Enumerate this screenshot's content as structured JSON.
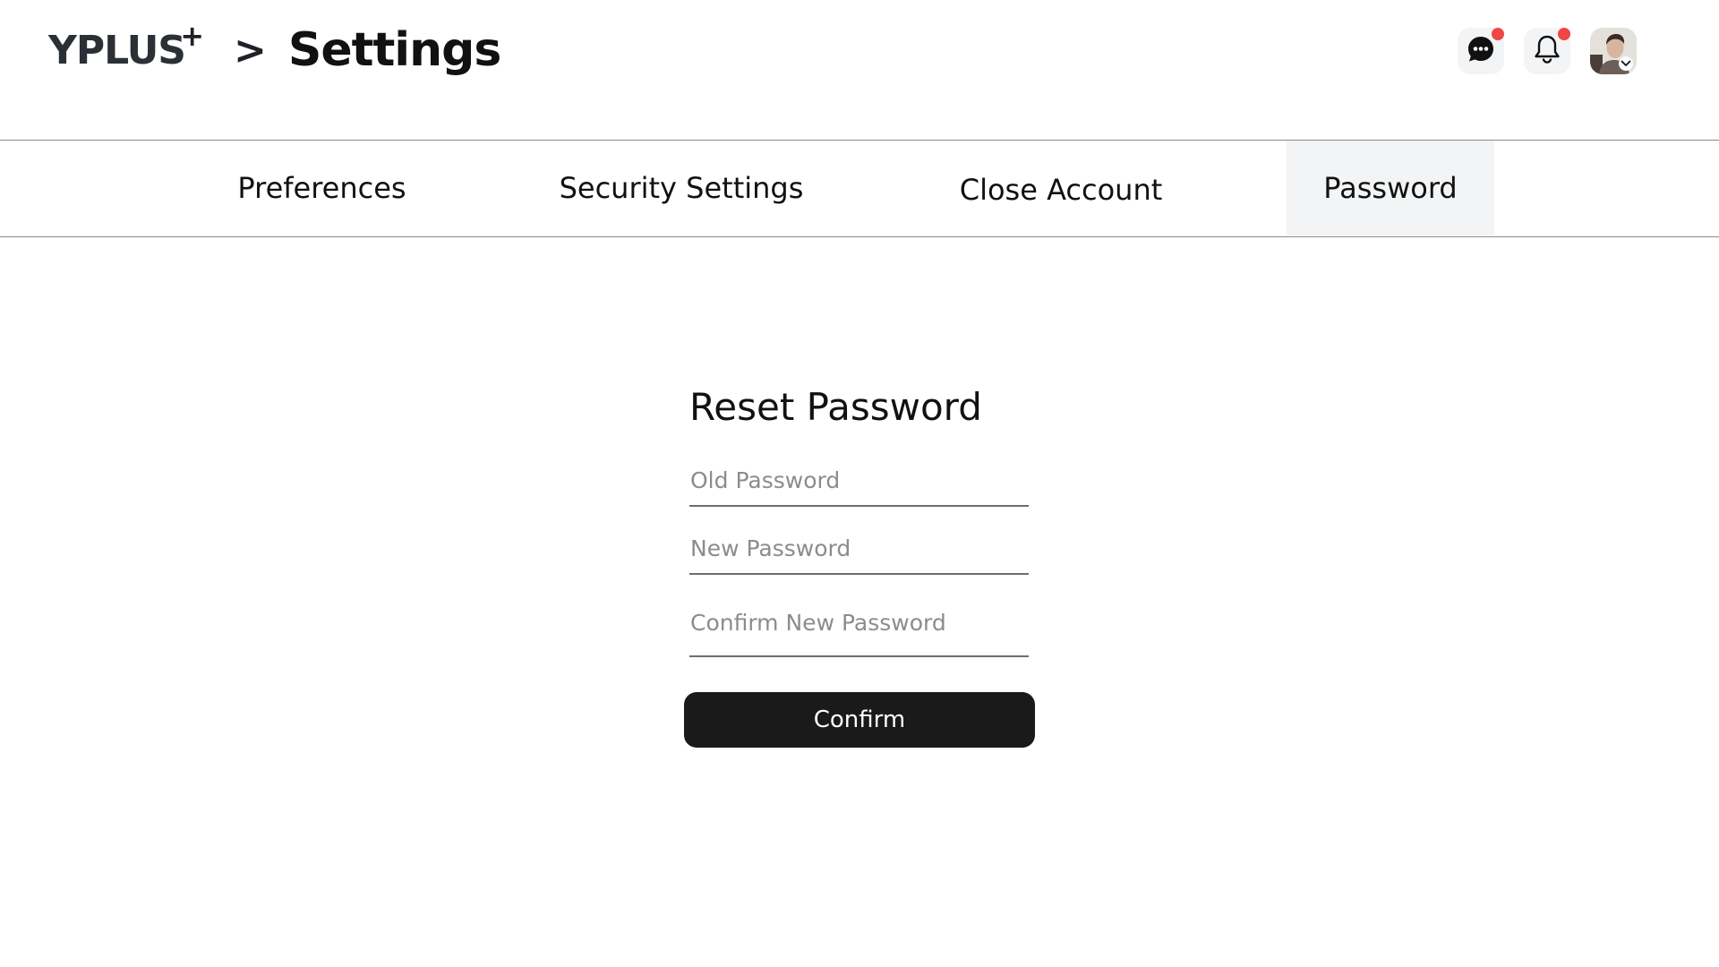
{
  "header": {
    "logo_text": "YPLUS",
    "logo_plus": "+",
    "breadcrumb_separator": ">",
    "page_title": "Settings",
    "messages_icon": "chat-bubble-icon",
    "notifications_icon": "bell-icon",
    "avatar_menu_icon": "chevron-down-icon",
    "badge_color": "#f04646"
  },
  "tabs": [
    {
      "label": "Preferences",
      "active": false
    },
    {
      "label": "Security Settings",
      "active": false
    },
    {
      "label": "Close Account",
      "active": false
    },
    {
      "label": "Password",
      "active": true
    }
  ],
  "form": {
    "title": "Reset Password",
    "old_password": {
      "value": "",
      "placeholder": "Old Password"
    },
    "new_password": {
      "value": "",
      "placeholder": "New Password"
    },
    "confirm_password": {
      "value": "",
      "placeholder": "Confirm New Password"
    },
    "confirm_label": "Confirm",
    "button_color": "#1a1a1a"
  }
}
